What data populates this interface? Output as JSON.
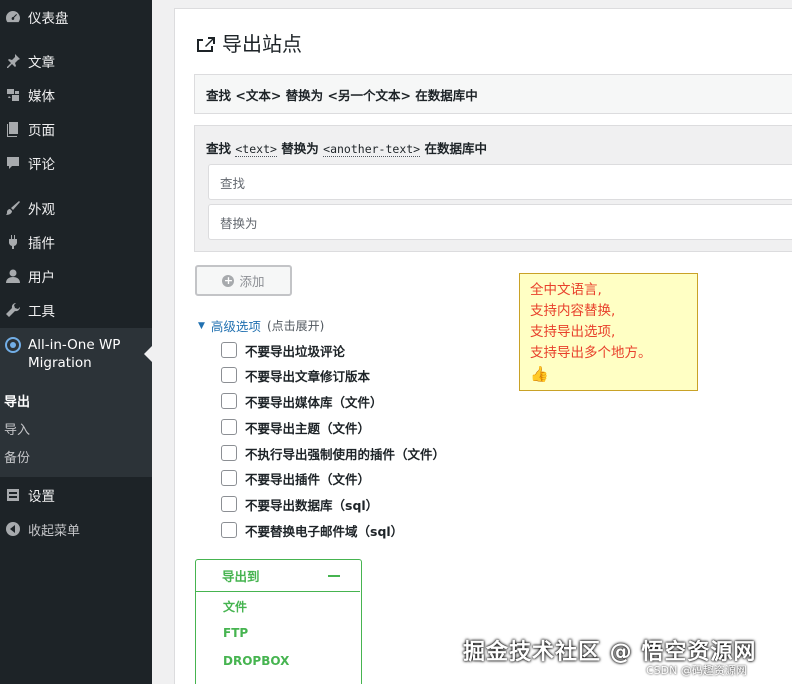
{
  "sidebar": {
    "items": [
      {
        "label": "仪表盘",
        "icon": "dashboard-icon"
      },
      {
        "label": "文章",
        "icon": "pin-icon"
      },
      {
        "label": "媒体",
        "icon": "media-icon"
      },
      {
        "label": "页面",
        "icon": "page-icon"
      },
      {
        "label": "评论",
        "icon": "comment-icon"
      },
      {
        "label": "外观",
        "icon": "brush-icon"
      },
      {
        "label": "插件",
        "icon": "plugin-icon"
      },
      {
        "label": "用户",
        "icon": "user-icon"
      },
      {
        "label": "工具",
        "icon": "wrench-icon"
      }
    ],
    "plugin": {
      "line1": "All-in-One WP",
      "line2": "Migration"
    },
    "submenu": [
      "导出",
      "导入",
      "备份"
    ],
    "settings": "设置",
    "collapse": "收起菜单"
  },
  "page": {
    "title": "导出站点"
  },
  "replace_box": {
    "title": "查找 <文本> 替换为 <另一个文本> 在数据库中"
  },
  "replace_form": {
    "prefix": "查找",
    "code1": "<text>",
    "middle": "替换为",
    "code2": "<another-text>",
    "suffix": "在数据库中",
    "find_placeholder": "查找",
    "replace_placeholder": "替换为",
    "add_label": "添加"
  },
  "note": {
    "lines": [
      "全中文语言,",
      "支持内容替换,",
      "支持导出选项,",
      "支持导出多个地方。"
    ],
    "emoji": "👍"
  },
  "advanced": {
    "label": "高级选项",
    "hint": "(点击展开)",
    "options": [
      "不要导出垃圾评论",
      "不要导出文章修订版本",
      "不要导出媒体库（文件）",
      "不要导出主题（文件）",
      "不执行导出强制使用的插件（文件）",
      "不要导出插件（文件）",
      "不要导出数据库（sql）",
      "不要替换电子邮件域（sql）"
    ]
  },
  "export_to": {
    "title": "导出到",
    "items": [
      "文件",
      "FTP",
      "DROPBOX"
    ]
  },
  "watermark": {
    "main": "掘金技术社区 @ 悟空资源网",
    "sub": "CSDN @码趣资源网"
  },
  "colors": {
    "sidebar_bg": "#1d2327",
    "accent_blue": "#2271b1",
    "export_green": "#46b450",
    "note_text": "#e8412c"
  }
}
